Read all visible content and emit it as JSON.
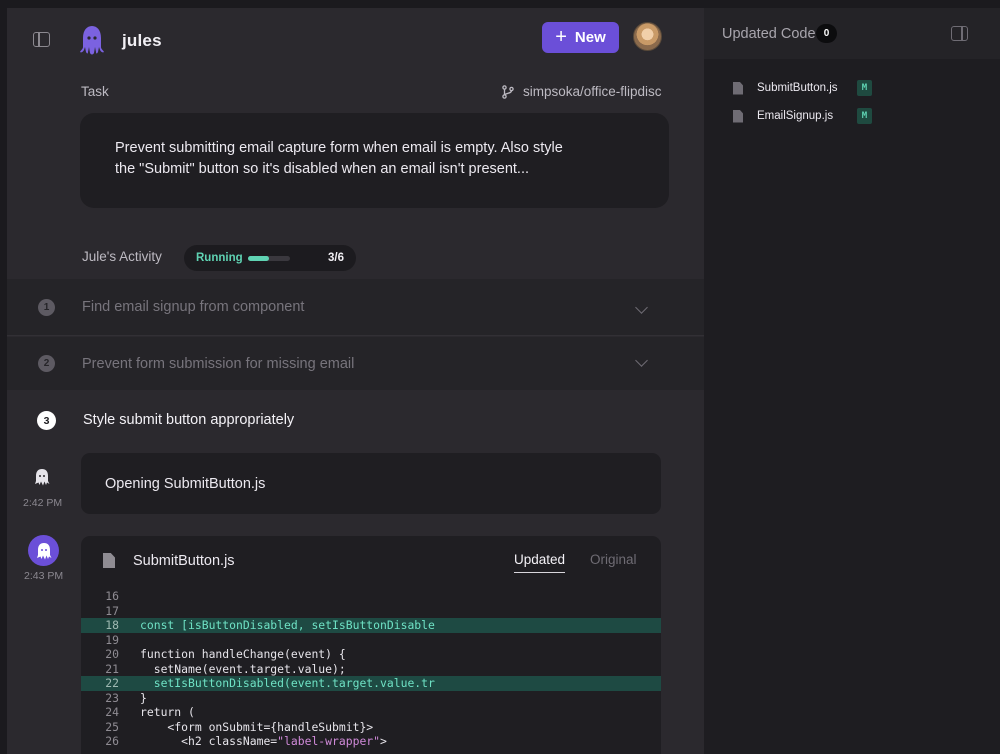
{
  "header": {
    "brand": "jules",
    "new_button_label": "New",
    "icons": [
      "sidebar-toggle-icon",
      "octopus-logo-icon",
      "plus-icon",
      "avatar"
    ]
  },
  "task": {
    "label": "Task",
    "repo": "simpsoka/office-flipdisc",
    "description": "Prevent submitting email capture form when email is empty. Also style the \"Submit\" button so it's disabled when an email isn't present..."
  },
  "activity": {
    "label": "Jule's Activity",
    "status": "Running",
    "progress": 0.5,
    "steps_count": "3/6"
  },
  "steps": [
    {
      "number": "1",
      "title": "Find email signup from component"
    },
    {
      "number": "2",
      "title": "Prevent form submission for missing email"
    },
    {
      "number": "3",
      "title": "Style submit button appropriately"
    }
  ],
  "messages": [
    {
      "time": "2:42 PM",
      "text": "Opening SubmitButton.js"
    },
    {
      "time": "2:43 PM"
    }
  ],
  "code_view": {
    "filename": "SubmitButton.js",
    "tab_updated": "Updated",
    "tab_original": "Original",
    "lines": [
      {
        "n": "16",
        "code": "",
        "added": false
      },
      {
        "n": "17",
        "code": "",
        "added": false
      },
      {
        "n": "18",
        "code": "const [isButtonDisabled, setIsButtonDisable",
        "added": true
      },
      {
        "n": "19",
        "code": "",
        "added": false
      },
      {
        "n": "20",
        "code": "function handleChange(event) {",
        "added": false
      },
      {
        "n": "21",
        "code": "  setName(event.target.value);",
        "added": false
      },
      {
        "n": "22",
        "code": "  setIsButtonDisabled(event.target.value.tr",
        "added": true
      },
      {
        "n": "23",
        "code": "}",
        "added": false
      },
      {
        "n": "24",
        "code": "return (",
        "added": false
      },
      {
        "n": "25",
        "code": "    <form onSubmit={handleSubmit}>",
        "added": false
      },
      {
        "n": "26",
        "code": "      <h2 className=\"label-wrapper\">",
        "added": false
      }
    ]
  },
  "updated_code_panel": {
    "title": "Updated Code",
    "count": "0",
    "files": [
      {
        "name": "SubmitButton.js",
        "status": "M"
      },
      {
        "name": "EmailSignup.js",
        "status": "M"
      }
    ]
  },
  "colors": {
    "accent": "#6b4fd8",
    "success": "#5fd3b3",
    "added_line_bg": "#1e4a43"
  }
}
